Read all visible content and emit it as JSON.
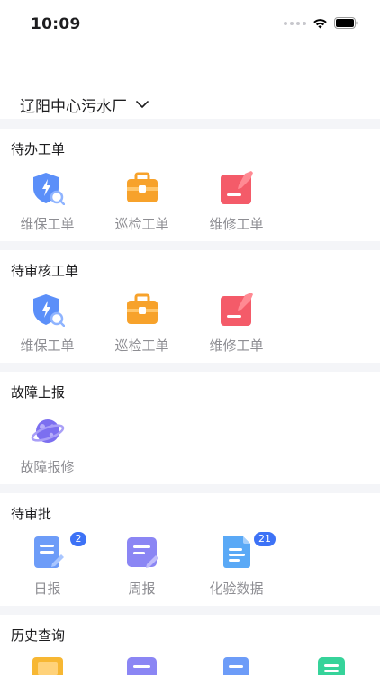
{
  "status_bar": {
    "time": "10:09"
  },
  "header": {
    "plant_name": "辽阳中心污水厂"
  },
  "sections": {
    "pending": {
      "title": "待办工单",
      "items": [
        {
          "label": "维保工单",
          "icon": "maintenance-shield-icon"
        },
        {
          "label": "巡检工单",
          "icon": "inspection-toolbox-icon"
        },
        {
          "label": "维修工单",
          "icon": "repair-edit-icon"
        }
      ]
    },
    "review": {
      "title": "待审核工单",
      "items": [
        {
          "label": "维保工单",
          "icon": "maintenance-shield-icon"
        },
        {
          "label": "巡检工单",
          "icon": "inspection-toolbox-icon"
        },
        {
          "label": "维修工单",
          "icon": "repair-edit-icon"
        }
      ]
    },
    "fault": {
      "title": "故障上报",
      "items": [
        {
          "label": "故障报修",
          "icon": "planet-icon"
        }
      ]
    },
    "approval": {
      "title": "待审批",
      "items": [
        {
          "label": "日报",
          "icon": "daily-report-icon",
          "badge": "2"
        },
        {
          "label": "周报",
          "icon": "weekly-report-icon"
        },
        {
          "label": "化验数据",
          "icon": "lab-data-icon",
          "badge": "21"
        }
      ]
    },
    "history": {
      "title": "历史查询"
    }
  },
  "colors": {
    "accent": "#3d72f6",
    "shield": "#5b8ff9",
    "toolbox": "#f7a22b",
    "repair": "#f45b69",
    "planet": "#7c6ff0",
    "report": "#6d9cf8",
    "weekly": "#8b86f4",
    "lab": "#5aa9f6",
    "history_green": "#36d39a",
    "background": "#f4f5f8"
  }
}
